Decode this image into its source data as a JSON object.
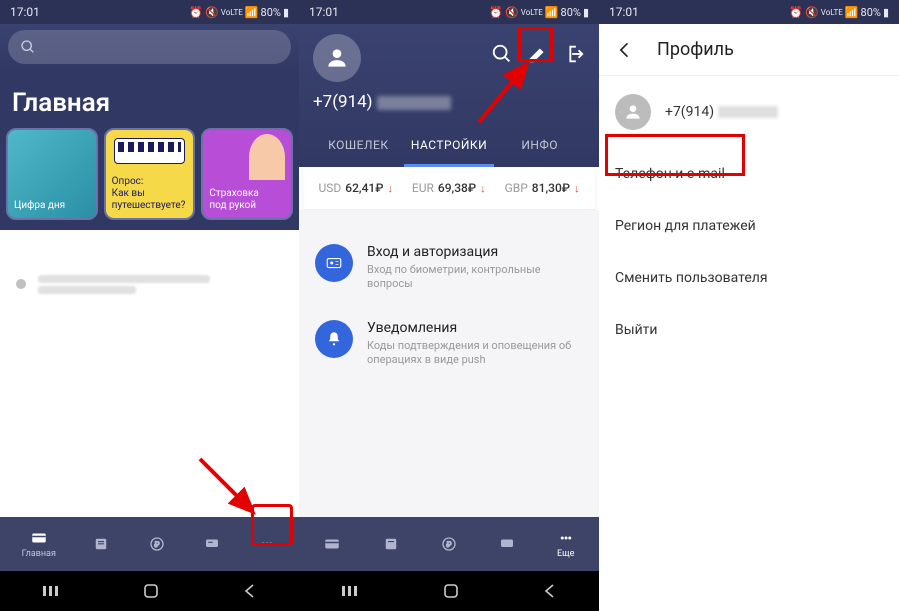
{
  "status": {
    "time": "17:01",
    "battery": "80%"
  },
  "screen1": {
    "title": "Главная",
    "cards": [
      {
        "label": "Цифра дня"
      },
      {
        "label": "Опрос:\nКак вы\nпутешествуете?"
      },
      {
        "label": "Страховка\nпод рукой"
      }
    ],
    "bottom": {
      "home": "Главная",
      "more": "Еще"
    }
  },
  "screen2": {
    "phone_prefix": "+7(914)",
    "tabs": {
      "wallet": "КОШЕЛЕК",
      "settings": "НАСТРОЙКИ",
      "info": "ИНФО"
    },
    "rates": [
      {
        "cur": "USD",
        "val": "62,41₽"
      },
      {
        "cur": "EUR",
        "val": "69,38₽"
      },
      {
        "cur": "GBP",
        "val": "81,30₽"
      }
    ],
    "items": [
      {
        "title": "Вход и авторизация",
        "sub": "Вход по биометрии, контрольные вопросы"
      },
      {
        "title": "Уведомления",
        "sub": "Коды подтверждения и оповещения об операциях в виде push"
      }
    ],
    "bottom": {
      "more": "Еще"
    }
  },
  "screen3": {
    "title": "Профиль",
    "phone_prefix": "+7(914)",
    "menu": [
      "Телефон и e-mail",
      "Регион для платежей",
      "Сменить пользователя",
      "Выйти"
    ]
  }
}
